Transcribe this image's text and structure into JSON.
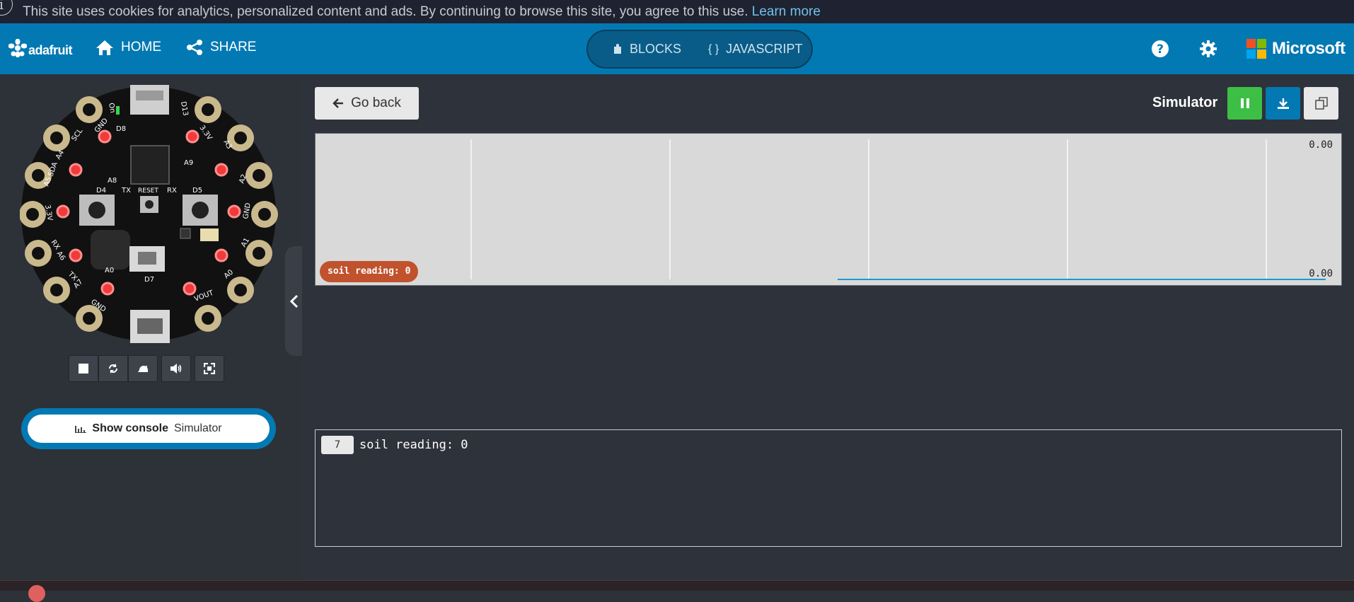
{
  "cookie": {
    "text": "This site uses cookies for analytics, personalized content and ads. By continuing to browse this site, you agree to this use.",
    "link": "Learn more",
    "info_glyph": "i"
  },
  "header": {
    "brand": "adafruit",
    "home": "HOME",
    "share": "SHARE",
    "modes": [
      {
        "label": "BLOCKS",
        "icon": "puzzle-icon"
      },
      {
        "label": "JAVASCRIPT",
        "icon": "braces-icon"
      }
    ],
    "microsoft": "Microsoft",
    "colors": {
      "bar": "#0379b3",
      "ms_red": "#f25022",
      "ms_green": "#7fba00",
      "ms_blue": "#00a4ef",
      "ms_yellow": "#ffb900"
    }
  },
  "board": {
    "labels": [
      "GND",
      "SCL",
      "A4",
      "SDA",
      "A5",
      "3.3V",
      "RX",
      "A6",
      "TX",
      "A7",
      "GND",
      "D8",
      "A8",
      "D4",
      "TX",
      "RESET",
      "RX",
      "D5",
      "A9",
      "3.3V",
      "A3",
      "A2",
      "GND",
      "A1",
      "A0",
      "VOUT",
      "D13",
      "On",
      "A0",
      "D7"
    ],
    "controls": [
      "stop-icon",
      "restart-icon",
      "slow-mo-icon",
      "mute-icon",
      "fullscreen-icon"
    ]
  },
  "console": {
    "button_bold": "Show console",
    "button_rest": "Simulator"
  },
  "toolbar": {
    "go_back": "Go back",
    "simulator": "Simulator",
    "pause_color": "#3dbf45",
    "download_color": "#0379b3"
  },
  "chart_data": {
    "type": "line",
    "series": [
      {
        "name": "soil reading",
        "values": [
          0,
          0
        ]
      }
    ],
    "y_max_label": "0.00",
    "y_min_label": "0.00",
    "pill": "soil reading: 0"
  },
  "log": {
    "count": "7",
    "text": "soil reading: 0"
  }
}
